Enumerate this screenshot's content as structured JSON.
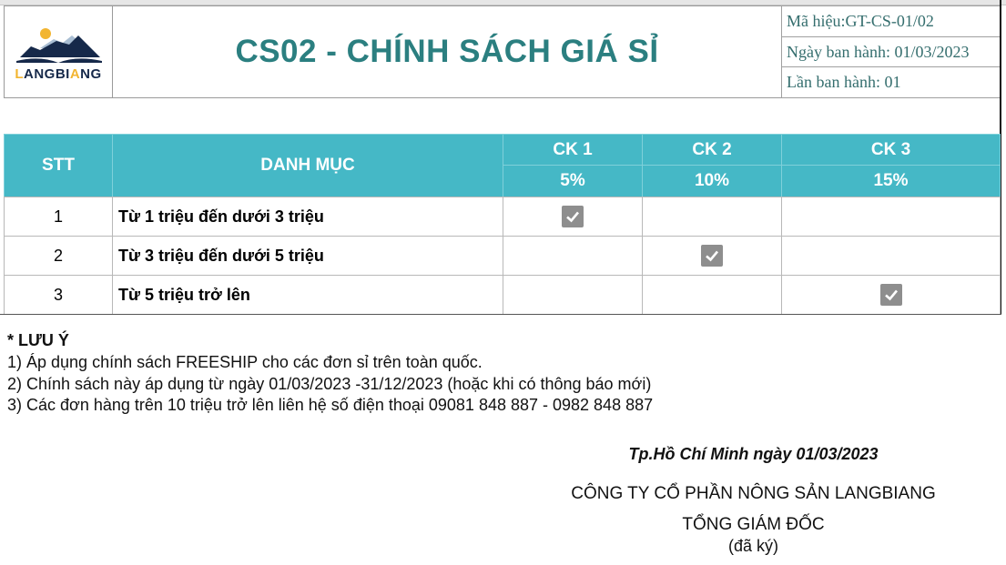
{
  "header": {
    "logo_text": "LANGBIANG",
    "title": "CS02 - CHÍNH SÁCH GIÁ SỈ",
    "code": "Mã hiệu:GT-CS-01/02",
    "issue_date": "Ngày ban hành: 01/03/2023",
    "revision": "Lần ban hành: 01"
  },
  "table": {
    "headers": {
      "stt": "STT",
      "category": "DANH MỤC",
      "ck1": "CK 1",
      "ck2": "CK 2",
      "ck3": "CK 3",
      "ck1_pct": "5%",
      "ck2_pct": "10%",
      "ck3_pct": "15%"
    },
    "rows": [
      {
        "stt": "1",
        "category": "Từ 1 triệu đến dưới 3 triệu",
        "checked": [
          true,
          false,
          false
        ]
      },
      {
        "stt": "2",
        "category": "Từ 3 triệu đến dưới 5 triệu",
        "checked": [
          false,
          true,
          false
        ]
      },
      {
        "stt": "3",
        "category": "Từ 5 triệu trở lên",
        "checked": [
          false,
          false,
          true
        ]
      }
    ]
  },
  "notes": {
    "title": "* LƯU Ý",
    "items": [
      "1) Áp dụng chính sách FREESHIP cho các đơn sỉ trên toàn quốc.",
      "2) Chính sách này áp dụng từ ngày 01/03/2023 -31/12/2023 (hoặc khi có thông báo mới)",
      "3) Các đơn hàng trên 10 triệu trở lên liên hệ số điện thoại 09081 848 887 - 0982 848 887"
    ]
  },
  "signature": {
    "place_date": "Tp.Hồ Chí Minh ngày 01/03/2023",
    "company": "CÔNG TY CỔ PHẦN NÔNG SẢN LANGBIANG",
    "position": "TỔNG GIÁM ĐỐC",
    "signed": "(đã ký)"
  },
  "colors": {
    "header_bg": "#45b8c6",
    "title": "#2b7f80"
  }
}
